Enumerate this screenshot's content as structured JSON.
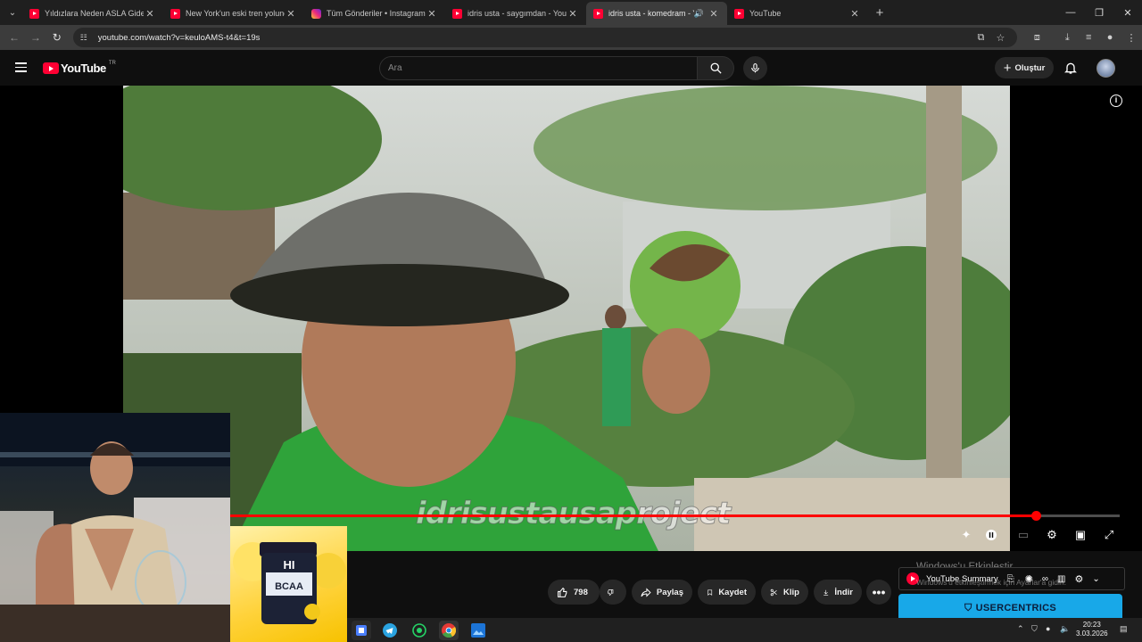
{
  "browser": {
    "tabs": [
      {
        "title": "Yıldızlara Neden ASLA Gidemey",
        "icon": "youtube",
        "active": false
      },
      {
        "title": "New York'un eski tren yolunda",
        "icon": "youtube",
        "active": false
      },
      {
        "title": "Tüm Gönderiler • Instagram",
        "icon": "instagram",
        "active": false
      },
      {
        "title": "idris usta - saygımdan - YouTub",
        "icon": "youtube",
        "active": false
      },
      {
        "title": "idris usta - komedram - You",
        "icon": "youtube",
        "active": true,
        "audio": true
      },
      {
        "title": "YouTube",
        "icon": "youtube",
        "active": false
      }
    ],
    "url": "youtube.com/watch?v=keuloAMS-t4&t=19s"
  },
  "youtube": {
    "logo_text": "YouTube",
    "country_code": "TR",
    "search_placeholder": "Ara",
    "create_label": "Oluştur"
  },
  "player": {
    "watermark_text": "idrisustausaproject",
    "progress_fraction": 0.906
  },
  "actions": {
    "like_count": "798",
    "share_label": "Paylaş",
    "save_label": "Kaydet",
    "clip_label": "Klip",
    "download_label": "İndir"
  },
  "overlay": {
    "windows_activate_title": "Windows'u Etkinleştir",
    "windows_activate_sub": "Windows'u etkinleştirmek için Ayarlar'a gidin.",
    "summary_label": "YouTube Summary",
    "usercentrics_label": "USERCENTRICS"
  },
  "taskbar": {
    "time": "20:23",
    "date": "3.03.2026"
  },
  "colors": {
    "accent": "#ff0033",
    "background": "#0f0f0f",
    "progress": "#ff0000"
  }
}
